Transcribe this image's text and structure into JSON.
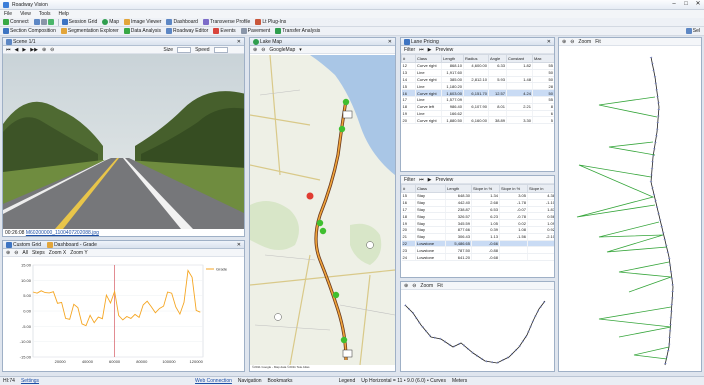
{
  "window": {
    "title": "Roadway Vision"
  },
  "menu": [
    "File",
    "View",
    "Tools",
    "Help"
  ],
  "toolbar1": [
    {
      "label": "Connect"
    },
    {
      "label": "Session Grid"
    },
    {
      "label": "Map"
    },
    {
      "label": "Image Viewer"
    },
    {
      "label": "Dashboard"
    },
    {
      "label": "Transverse Profile"
    },
    {
      "label": "Lt Plug-Ins"
    }
  ],
  "toolbar2": [
    {
      "label": "Section Composition"
    },
    {
      "label": "Segmentation Explorer"
    },
    {
      "label": "Data Analysis"
    },
    {
      "label": "Roadway Editor"
    },
    {
      "label": "Events"
    },
    {
      "label": "Pavement"
    },
    {
      "label": "Transfer Analysis"
    }
  ],
  "toolbar2_right": "Sel",
  "image_panel": {
    "tab": "Scene 1/1",
    "controls": [
      "Size",
      "Speed"
    ],
    "caption_prefix": "00:26:08",
    "caption_link": "M60200000_1100407202088.jpg"
  },
  "chart_panel": {
    "tabs": [
      "Custom Grid",
      "Dashboard - Grade"
    ],
    "toolbar": [
      "All",
      "Steps",
      "Zoom X",
      "Zoom Y"
    ]
  },
  "chart_data": {
    "type": "line",
    "series": [
      {
        "name": "Grade",
        "color": "#f5a623"
      }
    ],
    "legend": "top-right",
    "ylabels": [
      "15.00",
      "10.00",
      "5.00",
      "0.00",
      "-5.00",
      "-10.00",
      "-15.00"
    ],
    "xlabels": [
      "20000",
      "40000",
      "60000",
      "80000",
      "100000",
      "120000"
    ],
    "ylim": [
      -15,
      15
    ],
    "xlim": [
      0,
      125000
    ],
    "marker_x": 60000,
    "x": [
      0,
      3000,
      6000,
      9000,
      12000,
      15000,
      18000,
      21000,
      24000,
      27000,
      30000,
      33000,
      36000,
      39000,
      42000,
      45000,
      48000,
      51000,
      54000,
      57000,
      60000,
      63000,
      66000,
      69000,
      72000,
      75000,
      78000,
      81000,
      84000,
      87000,
      90000,
      93000,
      96000,
      99000,
      102000,
      105000,
      108000,
      111000,
      114000,
      117000,
      120000,
      123000
    ],
    "y": [
      6.2,
      5.8,
      6.6,
      6.0,
      5.9,
      6.3,
      2.5,
      2.8,
      -2.4,
      -2.7,
      2.2,
      1.1,
      -4.2,
      -4.8,
      -1.4,
      -3.8,
      -2.0,
      -2.5,
      5.2,
      2.6,
      6.4,
      -1.5,
      -2.9,
      -1.8,
      -2.4,
      -1.1,
      -2.1,
      2.0,
      3.2,
      1.4,
      -0.6,
      0.8,
      1.6,
      6.2,
      5.8,
      1.3,
      -1.0,
      2.8,
      13.2,
      11.0,
      0.2,
      -0.4
    ]
  },
  "map_panel": {
    "tab": "Lake Map",
    "toolbar": [
      "GoogleMap"
    ],
    "credit": "©2011 Google - Map data ©2011 Tele Atlas"
  },
  "geom_top": {
    "tab": "Lane Pricing",
    "toolbar": [
      "Filter",
      "Preview"
    ],
    "columns": [
      "#",
      "Class",
      "Length",
      "Radius",
      "Angle",
      "Constant",
      "Max"
    ],
    "rows": [
      [
        "12",
        "Curve right",
        "868.10",
        "4,600.00",
        "6.33",
        "1.82",
        "55"
      ],
      [
        "13",
        "Line",
        "1,917.60",
        "",
        "",
        "",
        "50"
      ],
      [
        "14",
        "Curve right",
        "385.00",
        "2,812.10",
        "5.93",
        "1.48",
        "50"
      ],
      [
        "15",
        "Line",
        "1,180.20",
        "",
        "",
        "",
        "28"
      ],
      [
        "16",
        "Curve right",
        "1,603.00",
        "6,151.70",
        "12.57",
        "4.24",
        "50"
      ],
      [
        "17",
        "Line",
        "1,577.09",
        "",
        "",
        "",
        "55"
      ],
      [
        "18",
        "Curve left",
        "986.40",
        "6,107.90",
        "8.01",
        "2.21",
        "8"
      ],
      [
        "19",
        "Line",
        "166.62",
        "",
        "",
        "",
        "6"
      ],
      [
        "20",
        "Curve right",
        "1,880.50",
        "6,160.00",
        "38.89",
        "3.30",
        "5"
      ]
    ]
  },
  "geom_bottom": {
    "toolbar": [
      "Filter",
      "Preview"
    ],
    "columns": [
      "#",
      "Class",
      "Length",
      "Slope in %",
      "Slope in %",
      "Slope in"
    ],
    "rows": [
      [
        "15",
        "Stay",
        "648.30",
        "1.34",
        "3.05",
        "4.38"
      ],
      [
        "16",
        "Stay",
        "442.40",
        "2.68",
        "-1.78",
        "-1.10"
      ],
      [
        "17",
        "Stay",
        "238.87",
        "6.53",
        "-0.07",
        "1.87"
      ],
      [
        "18",
        "Stay",
        "326.57",
        "6.23",
        "-0.78",
        "0.56"
      ],
      [
        "19",
        "Stay",
        "345.59",
        "1.05",
        "0.02",
        "1.09"
      ],
      [
        "20",
        "Stay",
        "877.66",
        "0.39",
        "1.08",
        "0.92"
      ],
      [
        "21",
        "Stay",
        "306.43",
        "1.13",
        "-1.56",
        "-2.10"
      ],
      [
        "22",
        "Lowstone",
        "5,486.65",
        "-0.66",
        "",
        ""
      ],
      [
        "23",
        "Lowstone",
        "787.50",
        "-0.88",
        "",
        ""
      ],
      [
        "24",
        "Lowstone",
        "641.20",
        "-0.68",
        "",
        ""
      ]
    ]
  },
  "profile_panel": {
    "toolbar": [
      "Zoom",
      "Fit"
    ]
  },
  "curv_panel": {
    "toolbar": [
      "Zoom",
      "Fit"
    ]
  },
  "status": {
    "left": "HI:74",
    "settings": "Settings",
    "web": "Web Connection",
    "navigation": "Navigation",
    "bookmarks": "Bookmarks",
    "legend": "Legend",
    "coords": "Up Horizontal = 11 • 9.0 (6.0) • Curves",
    "meters": "Meters"
  }
}
